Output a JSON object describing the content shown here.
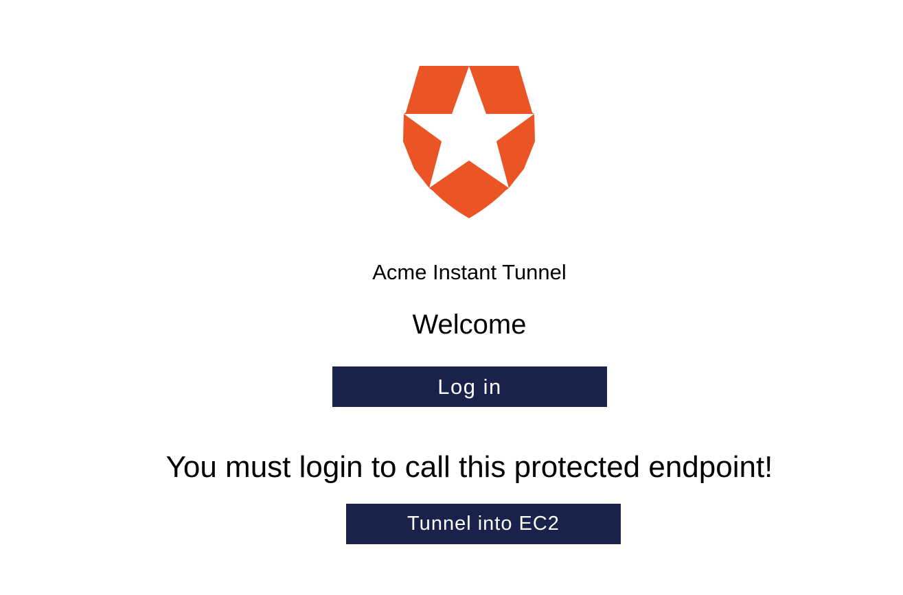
{
  "logo": {
    "icon": "auth-shield-star-icon",
    "color": "#eb5424"
  },
  "app_name": "Acme Instant Tunnel",
  "welcome_heading": "Welcome",
  "login_button_label": "Log in",
  "auth_message": "You must login to call this protected endpoint!",
  "tunnel_button_label": "Tunnel into EC2",
  "colors": {
    "button_bg": "#18224b",
    "button_text": "#ffffff",
    "page_bg": "#ffffff",
    "text": "#000000"
  }
}
